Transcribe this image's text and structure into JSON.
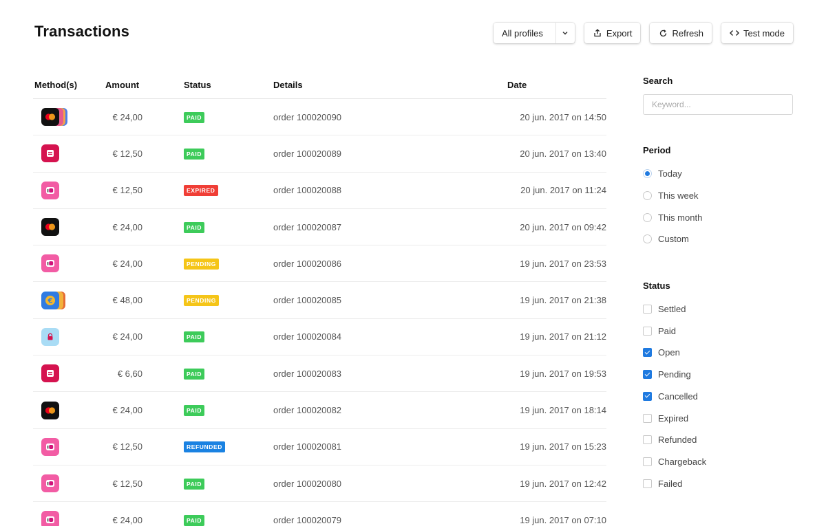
{
  "page": {
    "title": "Transactions"
  },
  "toolbar": {
    "profiles_label": "All profiles",
    "export_label": "Export",
    "refresh_label": "Refresh",
    "testmode_label": "Test mode"
  },
  "table": {
    "headers": {
      "method": "Method(s)",
      "amount": "Amount",
      "status": "Status",
      "details": "Details",
      "date": "Date"
    },
    "rows": [
      {
        "method": "creditcard-multi",
        "amount": "€ 24,00",
        "status": "PAID",
        "details": "order 100020090",
        "date": "20 jun. 2017 on 14:50"
      },
      {
        "method": "bancontact",
        "amount": "€ 12,50",
        "status": "PAID",
        "details": "order 100020089",
        "date": "20 jun. 2017 on 13:40"
      },
      {
        "method": "ideal",
        "amount": "€ 12,50",
        "status": "EXPIRED",
        "details": "order 100020088",
        "date": "20 jun. 2017 on 11:24"
      },
      {
        "method": "creditcard",
        "amount": "€ 24,00",
        "status": "PAID",
        "details": "order 100020087",
        "date": "20 jun. 2017 on 09:42"
      },
      {
        "method": "ideal",
        "amount": "€ 24,00",
        "status": "PENDING",
        "details": "order 100020086",
        "date": "19 jun. 2017 on 23:53"
      },
      {
        "method": "banktransfer-multi",
        "amount": "€ 48,00",
        "status": "PENDING",
        "details": "order 100020085",
        "date": "19 jun. 2017 on 21:38"
      },
      {
        "method": "paysafecard",
        "amount": "€ 24,00",
        "status": "PAID",
        "details": "order 100020084",
        "date": "19 jun. 2017 on 21:12"
      },
      {
        "method": "bancontact",
        "amount": "€ 6,60",
        "status": "PAID",
        "details": "order 100020083",
        "date": "19 jun. 2017 on 19:53"
      },
      {
        "method": "creditcard",
        "amount": "€ 24,00",
        "status": "PAID",
        "details": "order 100020082",
        "date": "19 jun. 2017 on 18:14"
      },
      {
        "method": "ideal",
        "amount": "€ 12,50",
        "status": "REFUNDED",
        "details": "order 100020081",
        "date": "19 jun. 2017 on 15:23"
      },
      {
        "method": "ideal",
        "amount": "€ 12,50",
        "status": "PAID",
        "details": "order 100020080",
        "date": "19 jun. 2017 on 12:42"
      },
      {
        "method": "ideal",
        "amount": "€ 24,00",
        "status": "PAID",
        "details": "order 100020079",
        "date": "19 jun. 2017 on 07:10"
      }
    ]
  },
  "status_colors": {
    "PAID": "#3dcb5a",
    "EXPIRED": "#f03e36",
    "PENDING": "#f5c518",
    "REFUNDED": "#1a82e2"
  },
  "sidebar": {
    "search": {
      "heading": "Search",
      "placeholder": "Keyword..."
    },
    "period": {
      "heading": "Period",
      "options": [
        {
          "label": "Today",
          "selected": true
        },
        {
          "label": "This week",
          "selected": false
        },
        {
          "label": "This month",
          "selected": false
        },
        {
          "label": "Custom",
          "selected": false
        }
      ]
    },
    "status": {
      "heading": "Status",
      "options": [
        {
          "label": "Settled",
          "checked": false
        },
        {
          "label": "Paid",
          "checked": false
        },
        {
          "label": "Open",
          "checked": true
        },
        {
          "label": "Pending",
          "checked": true
        },
        {
          "label": "Cancelled",
          "checked": true
        },
        {
          "label": "Expired",
          "checked": false
        },
        {
          "label": "Refunded",
          "checked": false
        },
        {
          "label": "Chargeback",
          "checked": false
        },
        {
          "label": "Failed",
          "checked": false
        }
      ]
    }
  }
}
